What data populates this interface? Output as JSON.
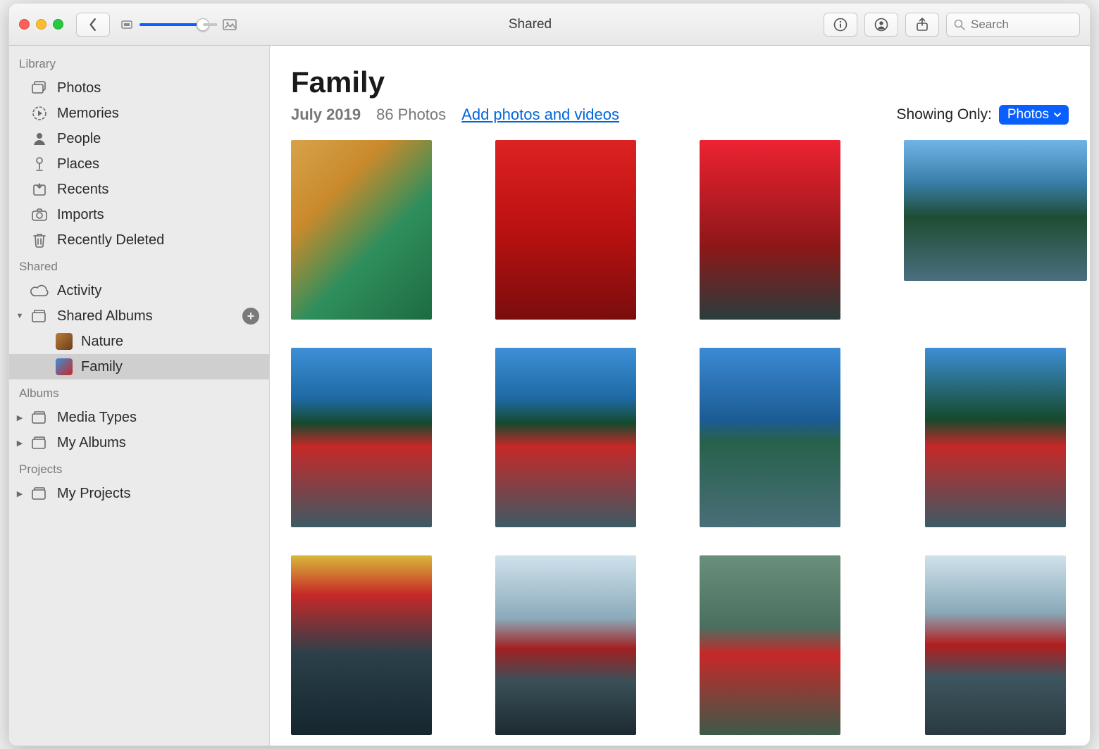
{
  "window": {
    "title": "Shared"
  },
  "toolbar": {
    "search_placeholder": "Search"
  },
  "sidebar": {
    "sections": {
      "library_label": "Library",
      "shared_label": "Shared",
      "albums_label": "Albums",
      "projects_label": "Projects"
    },
    "library": [
      {
        "label": "Photos"
      },
      {
        "label": "Memories"
      },
      {
        "label": "People"
      },
      {
        "label": "Places"
      },
      {
        "label": "Recents"
      },
      {
        "label": "Imports"
      },
      {
        "label": "Recently Deleted"
      }
    ],
    "shared": {
      "activity_label": "Activity",
      "shared_albums_label": "Shared Albums",
      "albums": [
        {
          "label": "Nature"
        },
        {
          "label": "Family"
        }
      ]
    },
    "albums": [
      {
        "label": "Media Types"
      },
      {
        "label": "My Albums"
      }
    ],
    "projects": [
      {
        "label": "My Projects"
      }
    ]
  },
  "main": {
    "title": "Family",
    "date": "July 2019",
    "count_text": "86 Photos",
    "add_link": "Add photos and videos",
    "showing_label": "Showing Only:",
    "filter_pill": "Photos"
  }
}
